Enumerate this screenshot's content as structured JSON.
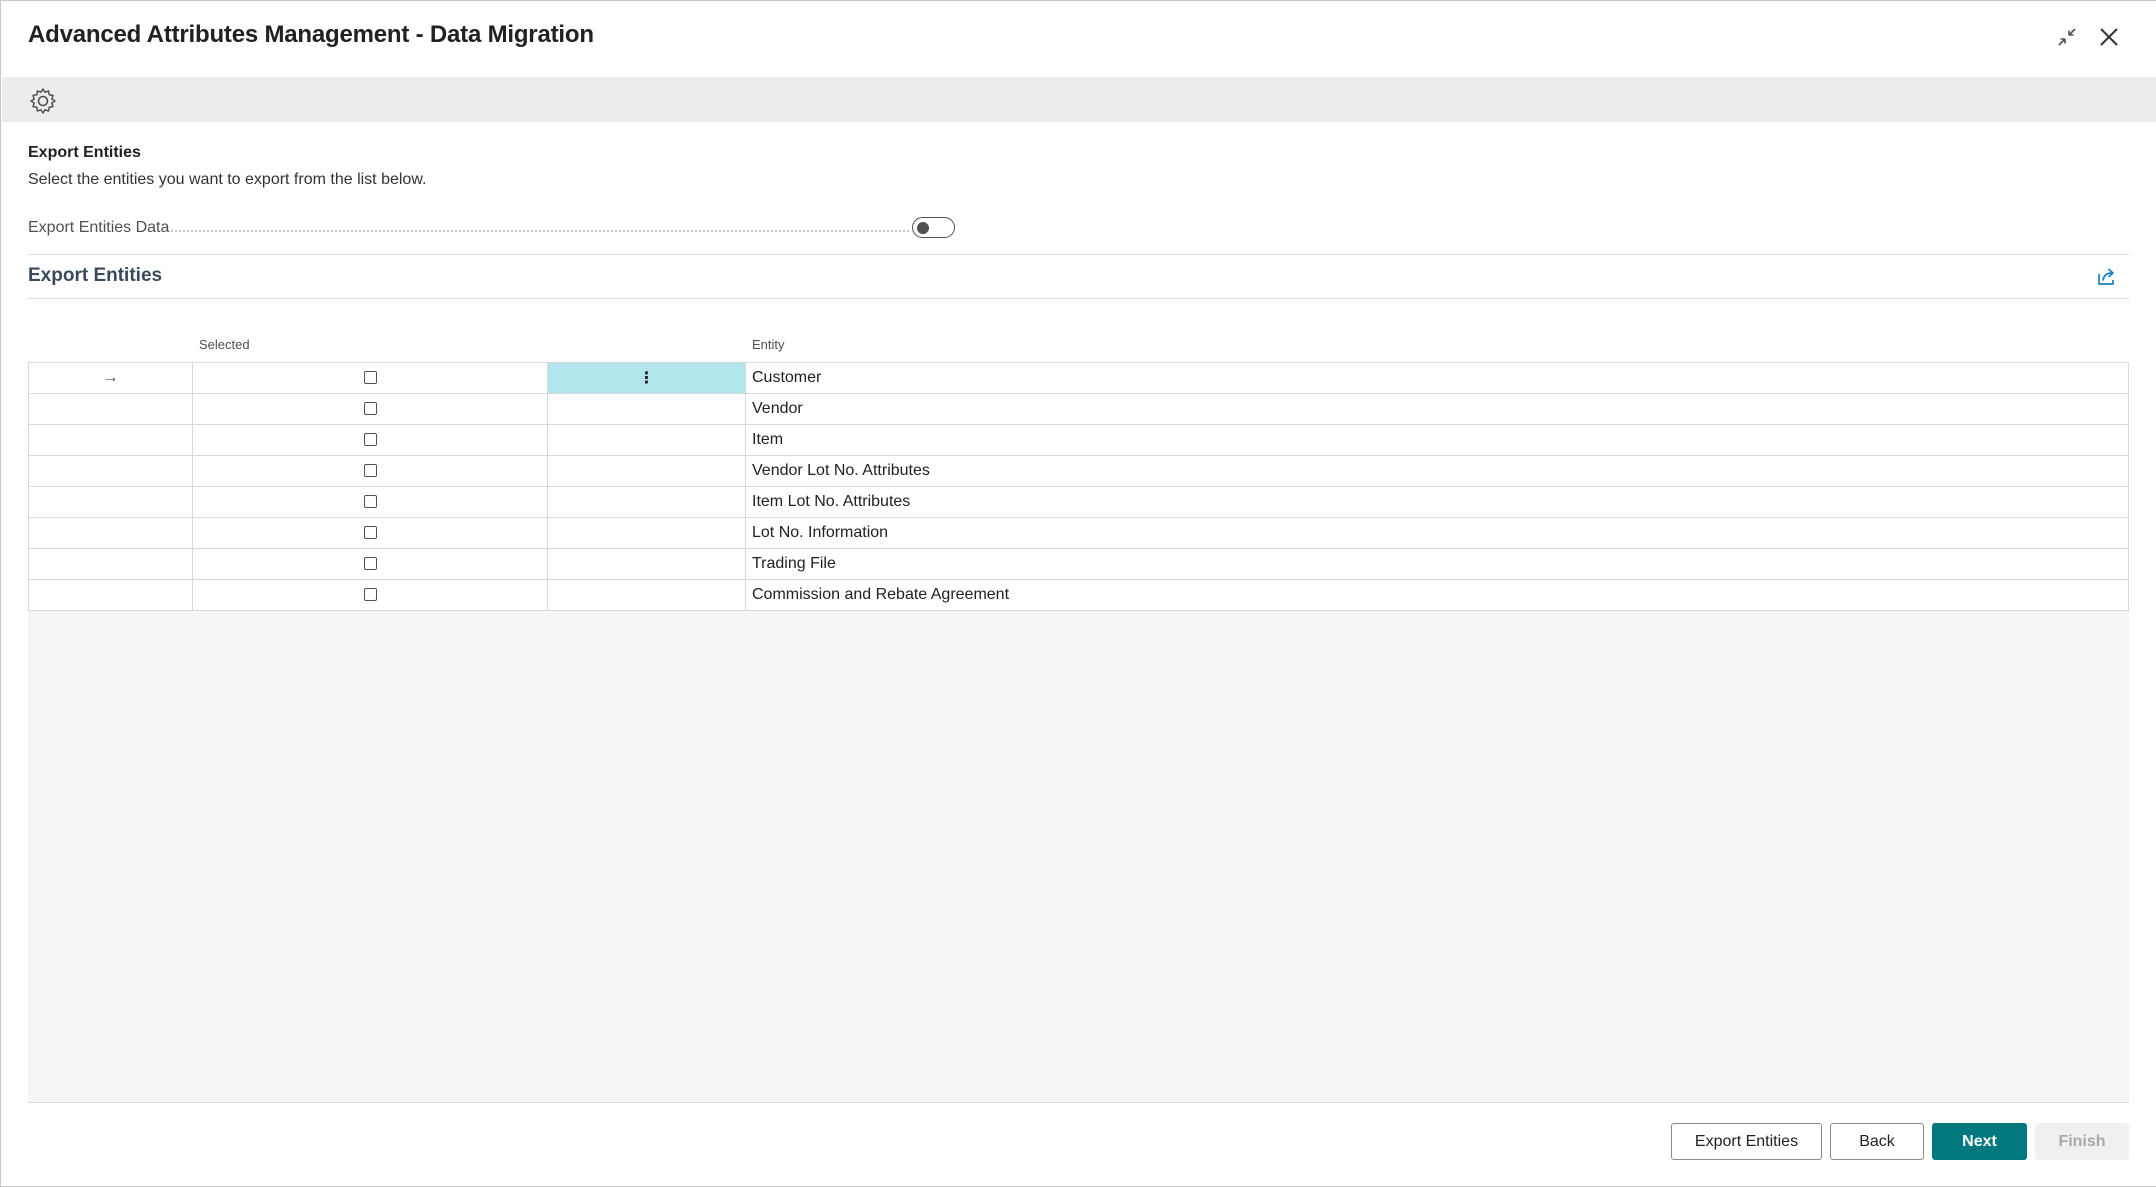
{
  "dialog": {
    "title": "Advanced Attributes Management - Data Migration",
    "collapse_icon": "collapse-icon",
    "close_icon": "close-icon"
  },
  "actionbar": {
    "settings_icon": "gear-icon"
  },
  "intro": {
    "heading": "Export Entities",
    "description": "Select the entities you want to export from the list below.",
    "field_label": "Export Entities Data",
    "toggle_on": false
  },
  "part": {
    "title": "Export Entities",
    "share_icon": "share-icon",
    "columns": {
      "selected": "Selected",
      "entity": "Entity"
    },
    "row_indicator": "→",
    "row_menu": "⋮",
    "rows": [
      {
        "selected": false,
        "entity": "Customer"
      },
      {
        "selected": false,
        "entity": "Vendor"
      },
      {
        "selected": false,
        "entity": "Item"
      },
      {
        "selected": false,
        "entity": "Vendor Lot No. Attributes"
      },
      {
        "selected": false,
        "entity": "Item Lot No. Attributes"
      },
      {
        "selected": false,
        "entity": "Lot No. Information"
      },
      {
        "selected": false,
        "entity": "Trading File"
      },
      {
        "selected": false,
        "entity": "Commission and Rebate Agreement"
      }
    ]
  },
  "footer": {
    "export_label": "Export Entities",
    "back_label": "Back",
    "next_label": "Next",
    "finish_label": "Finish"
  },
  "colors": {
    "primary": "#00787d",
    "active_cell": "#b3e5ec"
  }
}
